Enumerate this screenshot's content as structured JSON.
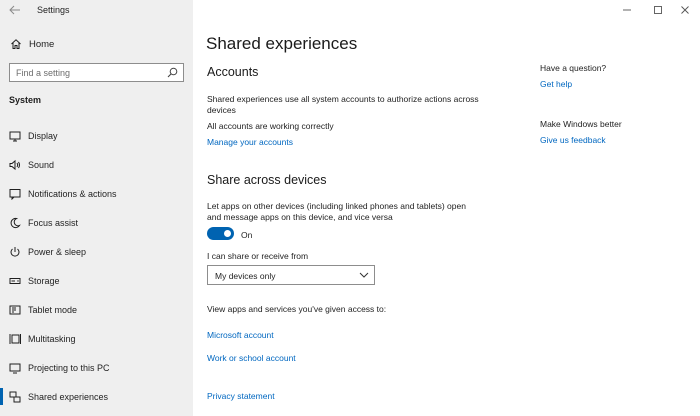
{
  "window": {
    "title": "Settings"
  },
  "sidebar": {
    "home_label": "Home",
    "search_placeholder": "Find a setting",
    "section_title": "System",
    "items": [
      {
        "label": "Display",
        "icon": "display-icon"
      },
      {
        "label": "Sound",
        "icon": "sound-icon"
      },
      {
        "label": "Notifications & actions",
        "icon": "notifications-icon"
      },
      {
        "label": "Focus assist",
        "icon": "focus-assist-icon"
      },
      {
        "label": "Power & sleep",
        "icon": "power-icon"
      },
      {
        "label": "Storage",
        "icon": "storage-icon"
      },
      {
        "label": "Tablet mode",
        "icon": "tablet-mode-icon"
      },
      {
        "label": "Multitasking",
        "icon": "multitasking-icon"
      },
      {
        "label": "Projecting to this PC",
        "icon": "projecting-icon"
      },
      {
        "label": "Shared experiences",
        "icon": "shared-experiences-icon",
        "active": true
      }
    ]
  },
  "main": {
    "title": "Shared experiences",
    "accounts": {
      "heading": "Accounts",
      "description_line1": "Shared experiences use all system accounts to authorize actions across",
      "description_line2": "devices",
      "status": "All accounts are working correctly",
      "manage_link": "Manage your accounts"
    },
    "share": {
      "heading": "Share across devices",
      "description_line1": "Let apps on other devices (including linked phones and tablets) open",
      "description_line2": "and message apps on this device, and vice versa",
      "toggle_state": "On",
      "share_label": "I can share or receive from",
      "share_value": "My devices only",
      "access_text": "View apps and services you've given access to:",
      "microsoft_account_link": "Microsoft account",
      "work_school_link": "Work or school account",
      "privacy_link": "Privacy statement"
    }
  },
  "help": {
    "question_heading": "Have a question?",
    "get_help_link": "Get help",
    "better_heading": "Make Windows better",
    "feedback_link": "Give us feedback"
  },
  "colors": {
    "accent": "#0063b1",
    "link": "#0067c0",
    "sidebar_bg": "#efefef"
  }
}
